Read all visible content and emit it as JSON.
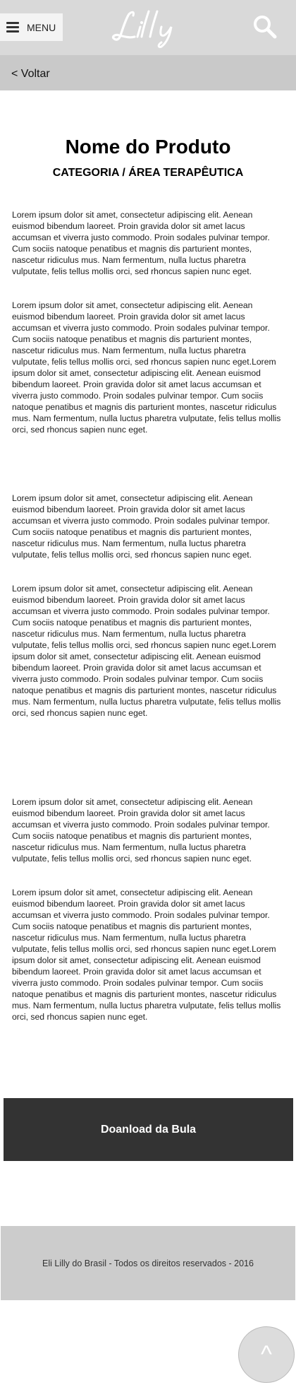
{
  "header": {
    "menu_label": "MENU",
    "logo_text": "Lilly",
    "search_icon": "search-icon"
  },
  "nav": {
    "back_label": "< Voltar"
  },
  "product": {
    "title": "Nome do Produto",
    "category": "CATEGORIA / ÁREA TERAPÊUTICA"
  },
  "sections": [
    {
      "p1": "Lorem ipsum dolor sit amet, consectetur adipiscing elit. Aenean euismod bibendum laoreet. Proin gravida dolor sit amet lacus accumsan et viverra justo commodo. Proin sodales pulvinar tempor. Cum sociis natoque penatibus et magnis dis parturient montes, nascetur ridiculus mus. Nam fermentum, nulla luctus pharetra vulputate, felis tellus mollis orci, sed rhoncus sapien nunc eget.",
      "p2": "Lorem ipsum dolor sit amet, consectetur adipiscing elit. Aenean euismod bibendum laoreet. Proin gravida dolor sit amet lacus accumsan et viverra justo commodo. Proin sodales pulvinar tempor. Cum sociis natoque penatibus et magnis dis parturient montes, nascetur ridiculus mus. Nam fermentum, nulla luctus pharetra vulputate, felis tellus mollis orci, sed rhoncus sapien nunc eget.Lorem ipsum dolor sit amet, consectetur adipiscing elit. Aenean euismod bibendum laoreet. Proin gravida dolor sit amet lacus accumsan et viverra justo commodo. Proin sodales pulvinar tempor. Cum sociis natoque penatibus et magnis dis parturient montes, nascetur ridiculus mus. Nam fermentum, nulla luctus pharetra vulputate, felis tellus mollis orci, sed rhoncus sapien nunc eget."
    },
    {
      "p1": "Lorem ipsum dolor sit amet, consectetur adipiscing elit. Aenean euismod bibendum laoreet. Proin gravida dolor sit amet lacus accumsan et viverra justo commodo. Proin sodales pulvinar tempor. Cum sociis natoque penatibus et magnis dis parturient montes, nascetur ridiculus mus. Nam fermentum, nulla luctus pharetra vulputate, felis tellus mollis orci, sed rhoncus sapien nunc eget.",
      "p2": "Lorem ipsum dolor sit amet, consectetur adipiscing elit. Aenean euismod bibendum laoreet. Proin gravida dolor sit amet lacus accumsan et viverra justo commodo. Proin sodales pulvinar tempor. Cum sociis natoque penatibus et magnis dis parturient montes, nascetur ridiculus mus. Nam fermentum, nulla luctus pharetra vulputate, felis tellus mollis orci, sed rhoncus sapien nunc eget.Lorem ipsum dolor sit amet, consectetur adipiscing elit. Aenean euismod bibendum laoreet. Proin gravida dolor sit amet lacus accumsan et viverra justo commodo. Proin sodales pulvinar tempor. Cum sociis natoque penatibus et magnis dis parturient montes, nascetur ridiculus mus. Nam fermentum, nulla luctus pharetra vulputate, felis tellus mollis orci, sed rhoncus sapien nunc eget."
    },
    {
      "p1": "Lorem ipsum dolor sit amet, consectetur adipiscing elit. Aenean euismod bibendum laoreet. Proin gravida dolor sit amet lacus accumsan et viverra justo commodo. Proin sodales pulvinar tempor. Cum sociis natoque penatibus et magnis dis parturient montes, nascetur ridiculus mus. Nam fermentum, nulla luctus pharetra vulputate, felis tellus mollis orci, sed rhoncus sapien nunc eget.",
      "p2": "Lorem ipsum dolor sit amet, consectetur adipiscing elit. Aenean euismod bibendum laoreet. Proin gravida dolor sit amet lacus accumsan et viverra justo commodo. Proin sodales pulvinar tempor. Cum sociis natoque penatibus et magnis dis parturient montes, nascetur ridiculus mus. Nam fermentum, nulla luctus pharetra vulputate, felis tellus mollis orci, sed rhoncus sapien nunc eget.Lorem ipsum dolor sit amet, consectetur adipiscing elit. Aenean euismod bibendum laoreet. Proin gravida dolor sit amet lacus accumsan et viverra justo commodo. Proin sodales pulvinar tempor. Cum sociis natoque penatibus et magnis dis parturient montes, nascetur ridiculus mus. Nam fermentum, nulla luctus pharetra vulputate, felis tellus mollis orci, sed rhoncus sapien nunc eget."
    }
  ],
  "download": {
    "label": "Doanload da Bula"
  },
  "footer": {
    "text": "Eli Lilly do Brasil - Todos os direitos reservados - 2016"
  },
  "back_to_top": {
    "icon": "chevron-up-icon",
    "glyph": "^"
  },
  "colors": {
    "header_bg": "#d9d9d9",
    "back_bar_bg": "#c9c9c9",
    "download_bg": "#333333",
    "footer_bg": "#cccccc"
  }
}
